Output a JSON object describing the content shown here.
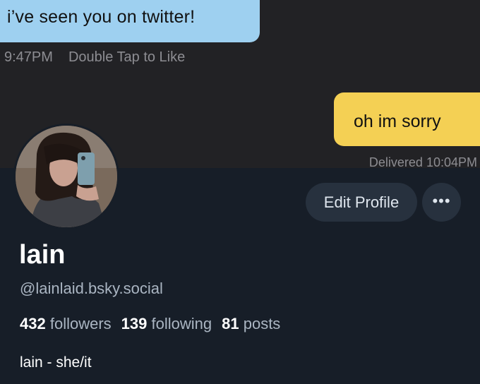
{
  "chat": {
    "incoming_message": "i’ve seen you on twitter!",
    "incoming_time": "9:47PM",
    "incoming_hint": "Double Tap to Like",
    "outgoing_message": "oh im sorry",
    "outgoing_status": "Delivered 10:04PM"
  },
  "profile": {
    "display_name": "lain",
    "handle": "@lainlaid.bsky.social",
    "followers_count": "432",
    "followers_label": "followers",
    "following_count": "139",
    "following_label": "following",
    "posts_count": "81",
    "posts_label": "posts",
    "bio": "lain - she/it",
    "edit_profile_label": "Edit Profile",
    "more_label": "•••",
    "avatar_icon": "profile-photo"
  },
  "colors": {
    "incoming_bubble": "#9ed0f0",
    "outgoing_bubble": "#f4d054",
    "chat_background": "#222225",
    "profile_background": "#171e28"
  }
}
